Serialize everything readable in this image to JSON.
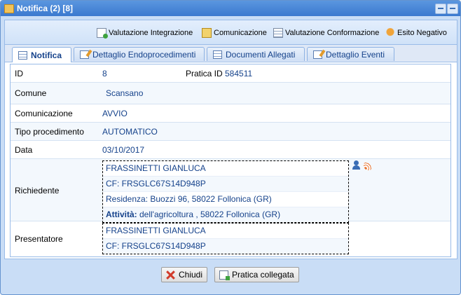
{
  "window": {
    "title": "Notifica (2) [8]"
  },
  "toolbar": {
    "valutazione_integrazione": "Valutazione Integrazione",
    "comunicazione": "Comunicazione",
    "valutazione_conformazione": "Valutazione Conformazione",
    "esito_negativo": "Esito Negativo"
  },
  "tabs": [
    {
      "label": "Notifica",
      "active": true
    },
    {
      "label": "Dettaglio Endoprocedimenti",
      "active": false
    },
    {
      "label": "Documenti Allegati",
      "active": false
    },
    {
      "label": "Dettaglio Eventi",
      "active": false
    }
  ],
  "form": {
    "id_label": "ID",
    "id_value": "8",
    "pratica_label": "Pratica ID",
    "pratica_value": "584511",
    "comune_label": "Comune",
    "comune_value": "Scansano",
    "comunicazione_label": "Comunicazione",
    "comunicazione_value": "AVVIO",
    "tipo_label": "Tipo procedimento",
    "tipo_value": "AUTOMATICO",
    "data_label": "Data",
    "data_value": "03/10/2017",
    "richiedente_label": "Richiedente",
    "richiedente": {
      "name": "FRASSINETTI GIANLUCA",
      "cf": "CF: FRSGLC67S14D948P",
      "residenza": "Residenza: Buozzi 96, 58022 Follonica (GR)",
      "attivita_label": "Attività:",
      "attivita_value": " dell'agricoltura , 58022 Follonica (GR)"
    },
    "presentatore_label": "Presentatore",
    "presentatore": {
      "name": "FRASSINETTI GIANLUCA",
      "cf": "CF: FRSGLC67S14D948P"
    }
  },
  "buttons": {
    "chiudi": "Chiudi",
    "pratica_collegata": "Pratica collegata"
  },
  "colors": {
    "titlebar": "#3b79cf",
    "link": "#15428b",
    "border": "#99bbe8"
  }
}
